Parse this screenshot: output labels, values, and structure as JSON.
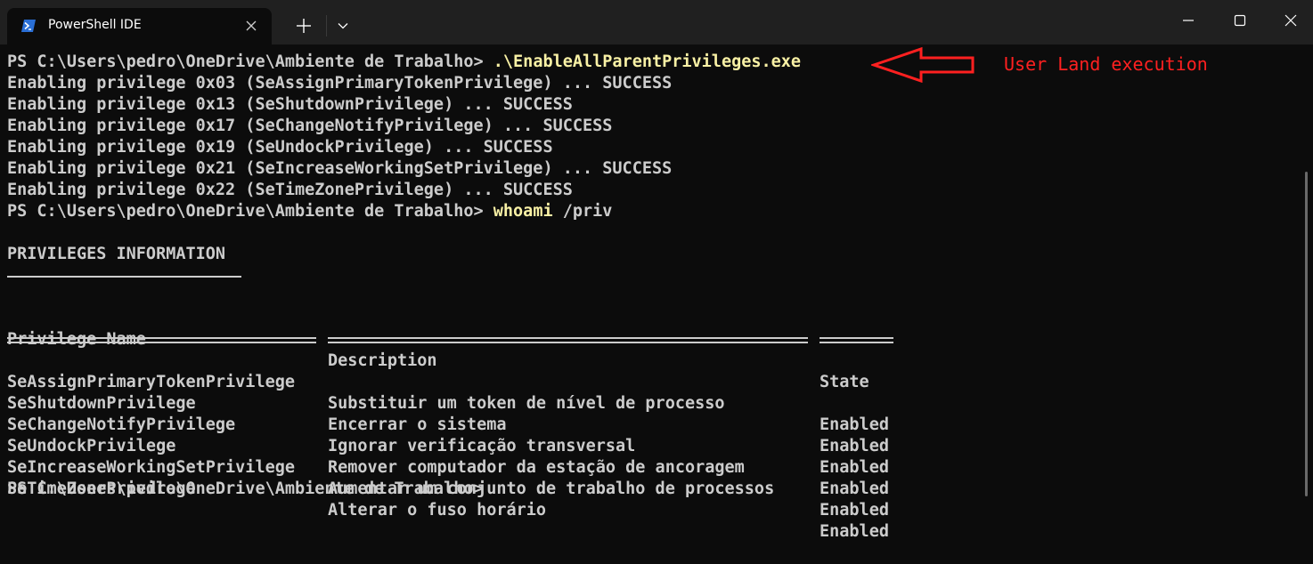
{
  "window": {
    "tab_title": "PowerShell IDE",
    "tab_icon": "powershell-icon",
    "controls": [
      "minimize-icon",
      "maximize-icon",
      "close-icon"
    ]
  },
  "terminal": {
    "prompt": "PS C:\\Users\\pedro\\OneDrive\\Ambiente de Trabalho> ",
    "command1": ".\\EnableAllParentPrivileges.exe",
    "output": [
      "Enabling privilege 0x03 (SeAssignPrimaryTokenPrivilege) ... SUCCESS",
      "Enabling privilege 0x13 (SeShutdownPrivilege) ... SUCCESS",
      "Enabling privilege 0x17 (SeChangeNotifyPrivilege) ... SUCCESS",
      "Enabling privilege 0x19 (SeUndockPrivilege) ... SUCCESS",
      "Enabling privilege 0x21 (SeIncreaseWorkingSetPrivilege) ... SUCCESS",
      "Enabling privilege 0x22 (SeTimeZonePrivilege) ... SUCCESS"
    ],
    "command2": "whoami",
    "command2_args": " /priv",
    "section_title": "PRIVILEGES INFORMATION",
    "table": {
      "headers": [
        "Privilege Name",
        "Description",
        "State"
      ],
      "rows": [
        [
          "SeAssignPrimaryTokenPrivilege",
          "Substituir um token de nível de processo",
          "Enabled"
        ],
        [
          "SeShutdownPrivilege",
          "Encerrar o sistema",
          "Enabled"
        ],
        [
          "SeChangeNotifyPrivilege",
          "Ignorar verificação transversal",
          "Enabled"
        ],
        [
          "SeUndockPrivilege",
          "Remover computador da estação de ancoragem",
          "Enabled"
        ],
        [
          "SeIncreaseWorkingSetPrivilege",
          "Aumentar um conjunto de trabalho de processos",
          "Enabled"
        ],
        [
          "SeTimeZonePrivilege",
          "Alterar o fuso horário",
          "Enabled"
        ]
      ]
    },
    "final_prompt": "PS C:\\Users\\pedro\\OneDrive\\Ambiente de Trabalho>"
  },
  "annotation": {
    "text": "User Land execution",
    "color": "#ff2020"
  },
  "colors": {
    "background": "#0c0c0c",
    "text": "#cccccc",
    "command": "#f9f1a5",
    "titlebar": "#202020"
  }
}
